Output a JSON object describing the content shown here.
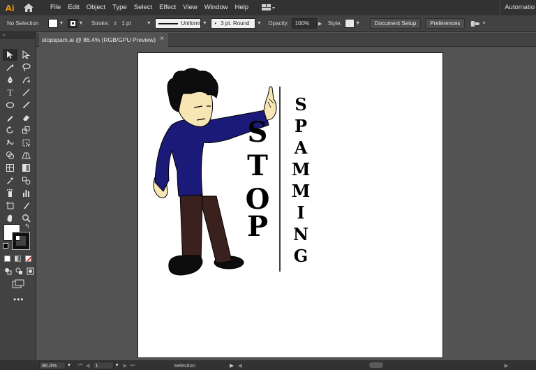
{
  "app": {
    "logo": "Ai",
    "workspace": "Automatio",
    "accent_color": "#ff9a00"
  },
  "menu": {
    "items": [
      "File",
      "Edit",
      "Object",
      "Type",
      "Select",
      "Effect",
      "View",
      "Window",
      "Help"
    ]
  },
  "control_bar": {
    "selection_label": "No Selection",
    "stroke_label": "Stroke:",
    "stroke_weight": "1 pt",
    "profile_label": "Uniform",
    "brush_label": "3 pt. Round",
    "opacity_label": "Opacity:",
    "opacity_value": "100%",
    "style_label": "Style:",
    "document_setup_button": "Document Setup",
    "preferences_button": "Preferences"
  },
  "document_tab": {
    "title": "stopspam.ai @ 86.4% (RGB/GPU Preview)",
    "close_glyph": "×"
  },
  "tools_panel": {
    "collapse_glyph": "«"
  },
  "artwork": {
    "headline_vertical": "STOP",
    "subline_vertical": "SPAMMING",
    "colors": {
      "hair": "#0d0d0d",
      "skin": "#f7e5b4",
      "shirt": "#1c1a78",
      "pants": "#3a211e",
      "shoes": "#0d0d0d",
      "divider": "#000000"
    }
  },
  "status_bar": {
    "zoom": "86.4%",
    "artboard_number": "1",
    "tool_status": "Selection"
  }
}
